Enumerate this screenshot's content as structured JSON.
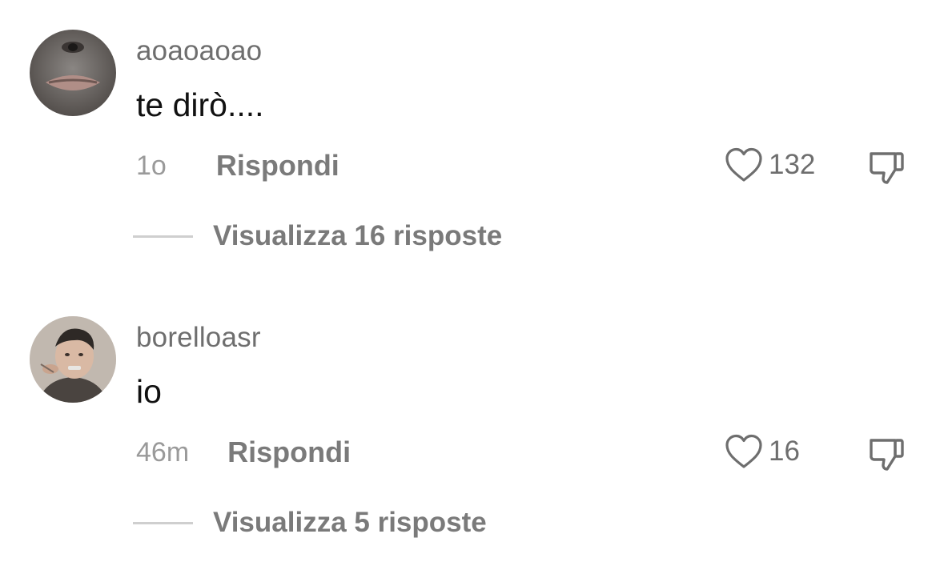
{
  "comments": [
    {
      "username": "aoaoaoao",
      "text": "te dirò....",
      "time": "1o",
      "reply_label": "Rispondi",
      "likes": "132",
      "view_replies_label": "Visualizza 16 risposte"
    },
    {
      "username": "borelloasr",
      "text": "io",
      "time": "46m",
      "reply_label": "Rispondi",
      "likes": "16",
      "view_replies_label": "Visualizza 5 risposte"
    }
  ],
  "icons": {
    "like": "heart-outline-icon",
    "dislike": "thumbs-down-icon"
  },
  "colors": {
    "username": "#6e6e6e",
    "text": "#111111",
    "meta": "#9a9a9a",
    "action": "#7a7a7a"
  }
}
